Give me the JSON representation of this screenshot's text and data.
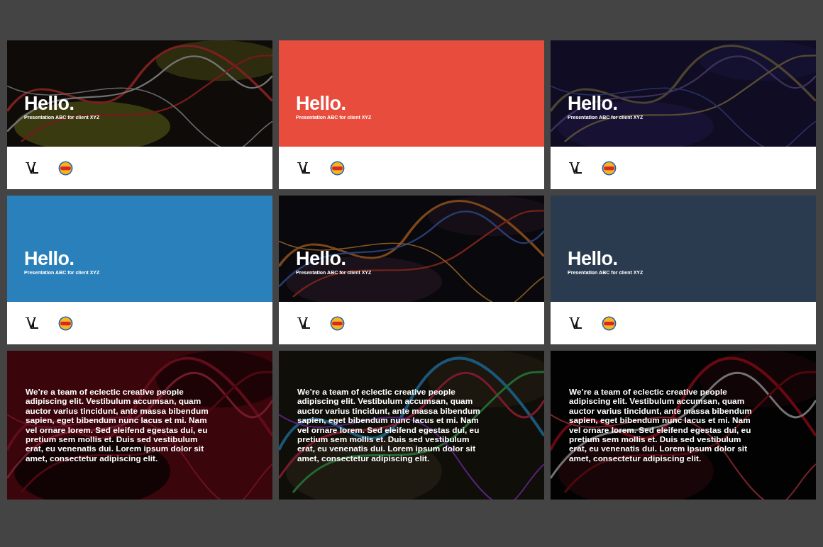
{
  "slides": [
    {
      "kind": "title",
      "heading": "Hello.",
      "subtitle": "Presentation ABC for client XYZ"
    },
    {
      "kind": "title",
      "background": {
        "kind": "solid",
        "color": "#e84c3d"
      },
      "heading": "Hello.",
      "subtitle": "Presentation ABC for client XYZ"
    },
    {
      "kind": "title",
      "heading": "Hello.",
      "subtitle": "Presentation ABC for client XYZ"
    },
    {
      "kind": "title",
      "background": {
        "kind": "solid",
        "color": "#2980ba"
      },
      "heading": "Hello.",
      "subtitle": "Presentation ABC for client XYZ"
    },
    {
      "kind": "title",
      "heading": "Hello.",
      "subtitle": "Presentation ABC for client XYZ"
    },
    {
      "kind": "title",
      "background": {
        "kind": "solid",
        "color": "#2b3b4f"
      },
      "heading": "Hello.",
      "subtitle": "Presentation ABC for client XYZ"
    },
    {
      "kind": "text",
      "body": "We’re a team of eclectic creative people adipiscing elit. Vestibulum accumsan, quam auctor varius tincidunt, ante massa bibendum sapien, eget bibendum nunc lacus et mi. Nam vel ornare lorem. Sed eleifend egestas dui, eu pretium sem mollis et. Duis sed vestibulum erat, eu venenatis dui. Lorem ipsum dolor sit amet, consectetur adipiscing elit."
    },
    {
      "kind": "text",
      "body": "We’re a team of eclectic creative people adipiscing elit. Vestibulum accumsan, quam auctor varius tincidunt, ante massa bibendum sapien, eget bibendum nunc lacus et mi. Nam vel ornare lorem. Sed eleifend egestas dui, eu pretium sem mollis et. Duis sed vestibulum erat, eu venenatis dui. Lorem ipsum dolor sit amet, consectetur adipiscing elit."
    },
    {
      "kind": "text",
      "body": "We’re a team of eclectic creative people adipiscing elit. Vestibulum accumsan, quam auctor varius tincidunt, ante massa bibendum sapien, eget bibendum nunc lacus et mi. Nam vel ornare lorem. Sed eleifend egestas dui, eu pretium sem mollis et. Duis sed vestibulum erat, eu venenatis dui. Lorem ipsum dolor sit amet, consectetur adipiscing elit."
    }
  ]
}
